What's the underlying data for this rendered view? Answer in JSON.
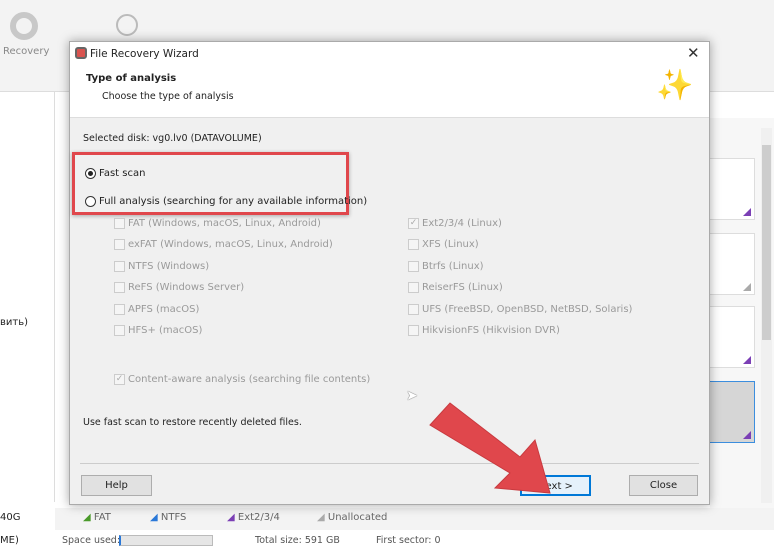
{
  "app": {
    "toolbar": {
      "recovery_label": "Recovery"
    },
    "left_fragments": [
      "вить)",
      "40G",
      "ME)"
    ]
  },
  "legend": [
    {
      "label": "FAT",
      "color": "#4a9a2a"
    },
    {
      "label": "NTFS",
      "color": "#2a78d8"
    },
    {
      "label": "Ext2/3/4",
      "color": "#7b3fb5"
    },
    {
      "label": "Unallocated",
      "color": "#aaaaaa"
    }
  ],
  "status": {
    "space_used_label": "Space used:",
    "total_size": "Total size: 591 GB",
    "first_sector": "First sector: 0"
  },
  "dialog": {
    "title": "File Recovery Wizard",
    "header_title": "Type of analysis",
    "header_subtitle": "Choose the type of analysis",
    "selected_disk": "Selected disk: vg0.lv0 (DATAVOLUME)",
    "scan_modes": [
      {
        "label": "Fast scan",
        "selected": true
      },
      {
        "label": "Full analysis (searching for any available information)",
        "selected": false
      }
    ],
    "fs_left": [
      {
        "label": "FAT (Windows, macOS, Linux, Android)",
        "checked": false
      },
      {
        "label": "exFAT (Windows, macOS, Linux, Android)",
        "checked": false
      },
      {
        "label": "NTFS (Windows)",
        "checked": false
      },
      {
        "label": "ReFS (Windows Server)",
        "checked": false
      },
      {
        "label": "APFS (macOS)",
        "checked": false
      },
      {
        "label": "HFS+ (macOS)",
        "checked": false
      }
    ],
    "fs_right": [
      {
        "label": "Ext2/3/4 (Linux)",
        "checked": true
      },
      {
        "label": "XFS (Linux)",
        "checked": false
      },
      {
        "label": "Btrfs (Linux)",
        "checked": false
      },
      {
        "label": "ReiserFS (Linux)",
        "checked": false
      },
      {
        "label": "UFS (FreeBSD, OpenBSD, NetBSD, Solaris)",
        "checked": false
      },
      {
        "label": "HikvisionFS (Hikvision DVR)",
        "checked": false
      }
    ],
    "content_aware": {
      "label": "Content-aware analysis (searching file contents)",
      "checked": true
    },
    "hint": "Use fast scan to restore recently deleted files.",
    "buttons": {
      "help": "Help",
      "next": "Next >",
      "close": "Close"
    }
  },
  "highlight_color": "#e0474c"
}
